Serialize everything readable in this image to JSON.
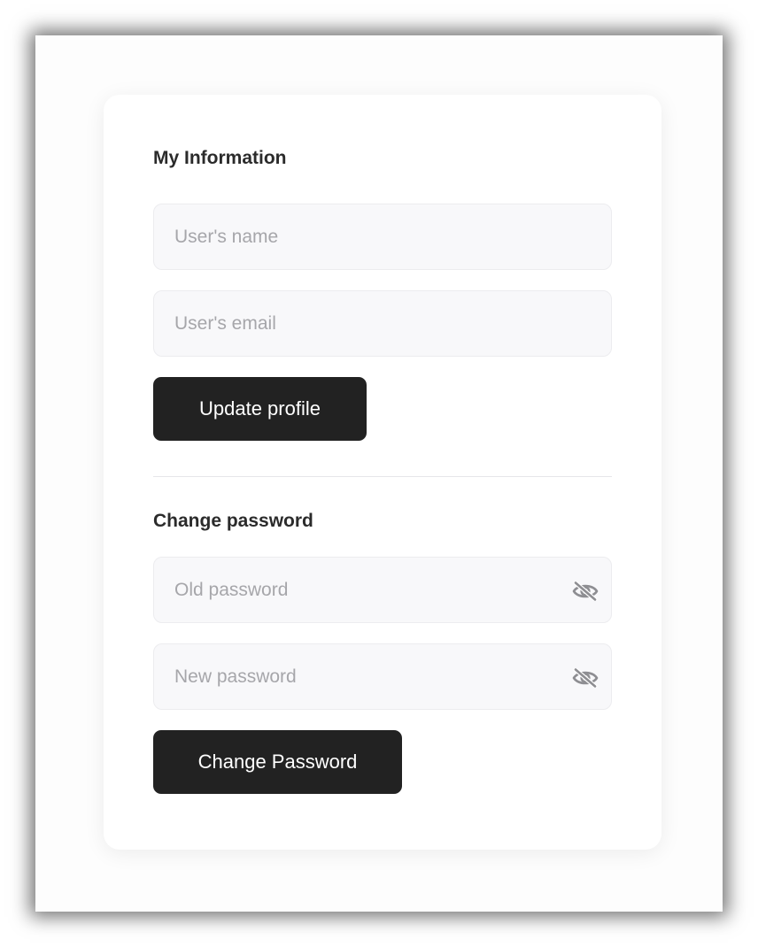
{
  "profile": {
    "title": "My Information",
    "name_placeholder": "User's name",
    "email_placeholder": "User's email",
    "update_button": "Update profile"
  },
  "password": {
    "title": "Change password",
    "old_placeholder": "Old password",
    "new_placeholder": "New password",
    "toggle_icon": "eye-off-icon",
    "change_button": "Change Password"
  },
  "colors": {
    "button_bg": "#222222",
    "field_bg": "#f8f8fa",
    "placeholder": "#a6a6aa"
  }
}
